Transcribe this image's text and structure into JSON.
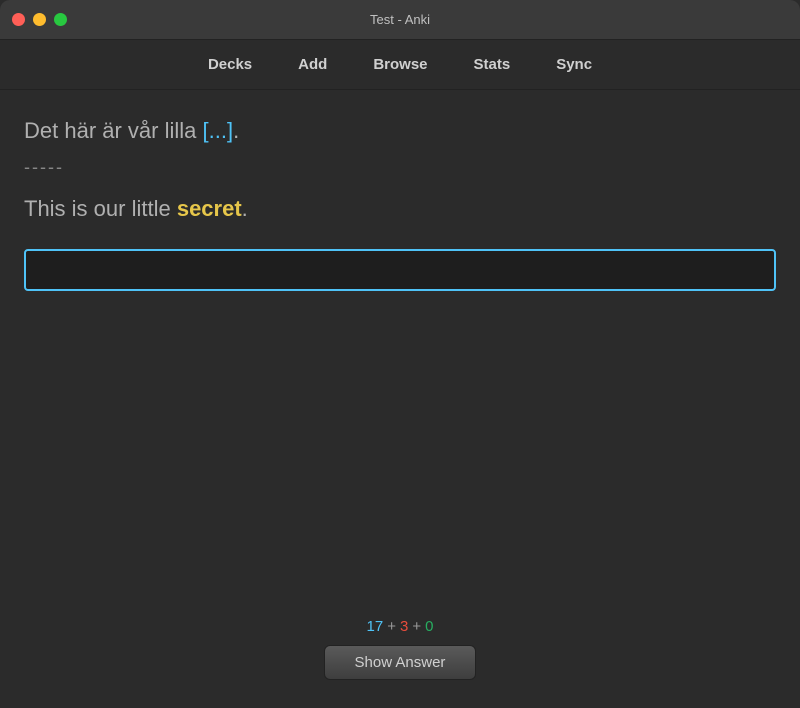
{
  "window": {
    "title": "Test - Anki"
  },
  "traffic_lights": {
    "close_label": "close",
    "minimize_label": "minimize",
    "maximize_label": "maximize"
  },
  "nav": {
    "items": [
      {
        "label": "Decks"
      },
      {
        "label": "Add"
      },
      {
        "label": "Browse"
      },
      {
        "label": "Stats"
      },
      {
        "label": "Sync"
      }
    ]
  },
  "card": {
    "front_text_before": "Det här är vår lilla ",
    "front_cloze": "[...]",
    "front_text_after": ".",
    "divider": "-----",
    "back_text_before": "This is our little ",
    "back_answer": "secret",
    "back_text_after": "."
  },
  "input": {
    "placeholder": ""
  },
  "footer": {
    "count_blue": "17",
    "plus1": "+",
    "count_red": "3",
    "plus2": "+",
    "count_green": "0",
    "show_answer_label": "Show Answer"
  }
}
